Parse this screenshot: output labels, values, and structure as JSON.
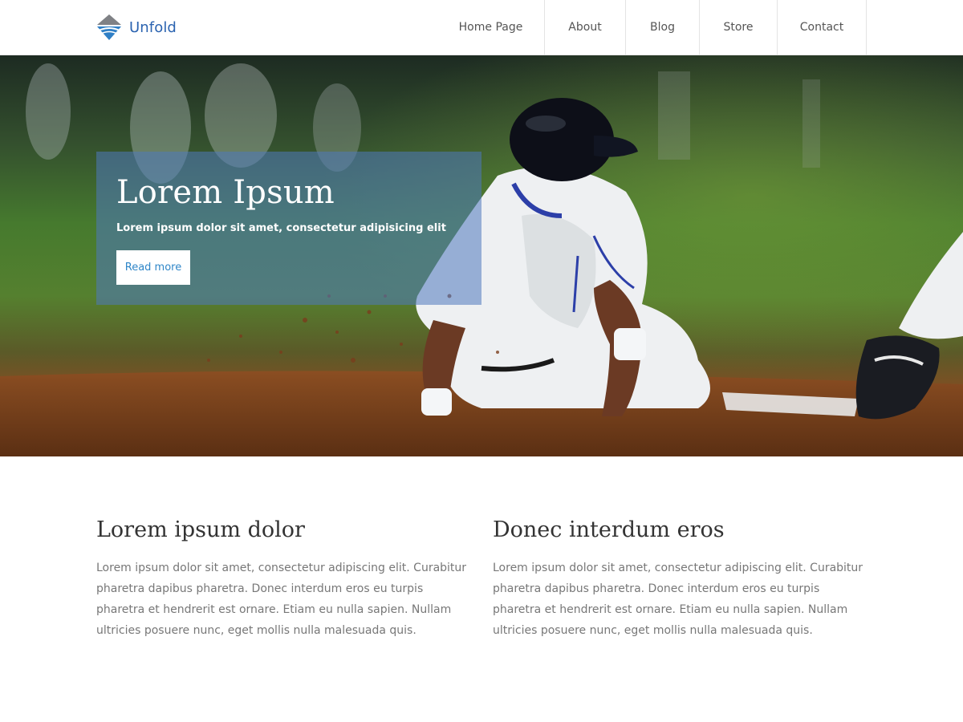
{
  "brand": {
    "name": "Unfold",
    "logo_icon": "diamond-logo-icon"
  },
  "nav": {
    "items": [
      {
        "label": "Home Page"
      },
      {
        "label": "About"
      },
      {
        "label": "Blog"
      },
      {
        "label": "Store"
      },
      {
        "label": "Contact"
      }
    ]
  },
  "hero": {
    "title": "Lorem Ipsum",
    "subtitle": "Lorem ipsum dolor sit amet, consectetur adipisicing elit",
    "button_label": "Read more",
    "image_subject": "baseball-player-sliding-image"
  },
  "content": {
    "columns": [
      {
        "heading": "Lorem ipsum dolor",
        "body": "Lorem ipsum dolor sit amet, consectetur adipiscing elit. Curabitur pharetra dapibus pharetra. Donec interdum eros eu turpis pharetra et hendrerit est ornare. Etiam eu nulla sapien. Nullam ultricies posuere nunc, eget mollis nulla malesuada quis."
      },
      {
        "heading": "Donec interdum eros",
        "body": "Lorem ipsum dolor sit amet, consectetur adipiscing elit. Curabitur pharetra dapibus pharetra. Donec interdum eros eu turpis pharetra et hendrerit est ornare. Etiam eu nulla sapien. Nullam ultricies posuere nunc, eget mollis nulla malesuada quis."
      }
    ]
  },
  "colors": {
    "brand": "#2b63b0",
    "hero_panel": "#4f78be",
    "button_text": "#2f86c8",
    "body_text": "#777777"
  }
}
